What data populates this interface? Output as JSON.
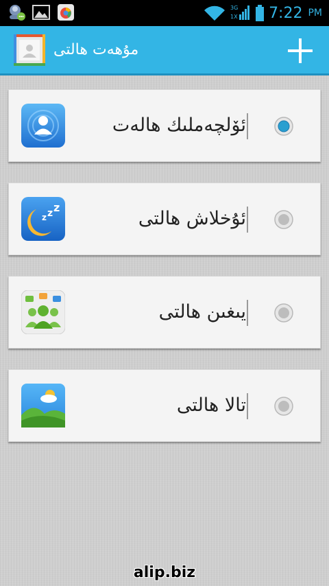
{
  "status_bar": {
    "time": "7:22",
    "ampm": "PM",
    "network_label_top": "3G",
    "network_label_bottom": "1X",
    "icons": [
      "chat-notification-icon",
      "gallery-notification-icon",
      "app-notification-icon",
      "wifi-icon",
      "signal-icon",
      "battery-icon"
    ]
  },
  "action_bar": {
    "title": "مۇھەت ھالتى",
    "logo_icon": "contacts-app-icon",
    "add_icon": "plus-icon",
    "color": "#33b5e5"
  },
  "profiles": [
    {
      "label": "ئۆلچەملىك ھالەت",
      "icon": "person-icon",
      "selected": true
    },
    {
      "label": "ئۇخلاش ھالتى",
      "icon": "sleep-moon-icon",
      "selected": false
    },
    {
      "label": "يىغىن ھالتى",
      "icon": "meeting-people-icon",
      "selected": false
    },
    {
      "label": "تالا ھالتى",
      "icon": "landscape-weather-icon",
      "selected": false
    }
  ],
  "watermark": "alip.biz",
  "colors": {
    "accent": "#33b5e5",
    "radio_selected": "#2a9fd0",
    "card_bg": "#f4f4f4"
  }
}
